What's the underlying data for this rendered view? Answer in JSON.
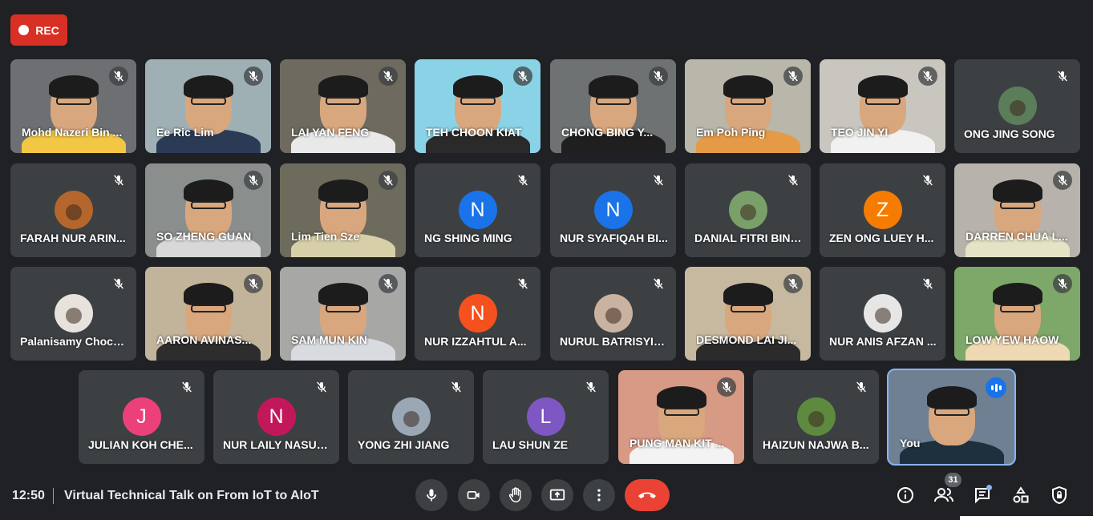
{
  "recording": {
    "label": "REC",
    "color": "#d93025"
  },
  "participants": [
    {
      "name": "Mohd Nazeri Bin ...",
      "type": "video",
      "bg": "#6d6f72",
      "shirt": "#f2c744"
    },
    {
      "name": "Ee Ric Lim",
      "type": "video",
      "bg": "#9fb0b5",
      "shirt": "#2b3a55"
    },
    {
      "name": "LAI YAN FENG",
      "type": "video",
      "bg": "#6e6a5f",
      "shirt": "#e9e9e9"
    },
    {
      "name": "TEH CHOON KIAT",
      "type": "video",
      "bg": "#8ad3e6",
      "shirt": "#2a2a2a"
    },
    {
      "name": "CHONG BING Y...",
      "type": "video",
      "bg": "#6f7272",
      "shirt": "#1f1f1f"
    },
    {
      "name": "Em Poh Ping",
      "type": "video",
      "bg": "#b9b6aa",
      "shirt": "#e59a47"
    },
    {
      "name": "TEO JIN YI",
      "type": "video",
      "bg": "#c9c6c0",
      "shirt": "#f1f1f1"
    },
    {
      "name": "ONG JING SONG",
      "type": "avatar-photo",
      "avatar_color": "#5c7d5a"
    },
    {
      "name": "FARAH NUR ARIN...",
      "type": "avatar-photo",
      "avatar_color": "#b4662c"
    },
    {
      "name": "SO ZHENG GUAN",
      "type": "video",
      "bg": "#8a8f8e",
      "shirt": "#d8d8d8"
    },
    {
      "name": "Lim Tien Sze",
      "type": "video",
      "bg": "#6d6b5c",
      "shirt": "#d7cfa7"
    },
    {
      "name": "NG SHING MING",
      "type": "avatar-letter",
      "letter": "N",
      "avatar_color": "#1a73e8"
    },
    {
      "name": "NUR SYAFIQAH BI...",
      "type": "avatar-letter",
      "letter": "N",
      "avatar_color": "#1a73e8"
    },
    {
      "name": "DANIAL FITRI BIN ...",
      "type": "avatar-photo",
      "avatar_color": "#7aa06a"
    },
    {
      "name": "ZEN ONG LUEY H...",
      "type": "avatar-letter",
      "letter": "Z",
      "avatar_color": "#f57c00"
    },
    {
      "name": "DARREN CHUA L...",
      "type": "video",
      "bg": "#b7b2ab",
      "shirt": "#e3e4c5"
    },
    {
      "name": "Palanisamy Chock...",
      "type": "avatar-photo",
      "avatar_color": "#e7e3dc"
    },
    {
      "name": "AARON AVINAS...",
      "type": "video",
      "bg": "#c2b49a",
      "shirt": "#2d2d2d"
    },
    {
      "name": "SAM MUN KIN",
      "type": "video",
      "bg": "#a7a8a6",
      "shirt": "#d8dbe0"
    },
    {
      "name": "NUR IZZAHTUL A...",
      "type": "avatar-letter",
      "letter": "N",
      "avatar_color": "#f4511e"
    },
    {
      "name": "NURUL BATRISYIA ...",
      "type": "avatar-photo",
      "avatar_color": "#c9b3a0"
    },
    {
      "name": "DESMOND LAI JI...",
      "type": "video",
      "bg": "#c7b8a0",
      "shirt": "#2b2b2b"
    },
    {
      "name": "NUR ANIS AFZAN ...",
      "type": "avatar-photo",
      "avatar_color": "#e6e6e6"
    },
    {
      "name": "LOW YEW HAOW",
      "type": "video",
      "bg": "#7ea86a",
      "shirt": "#efd9b4"
    },
    {
      "name": "JULIAN KOH CHE...",
      "type": "avatar-letter",
      "letter": "J",
      "avatar_color": "#ec407a"
    },
    {
      "name": "NUR LAILY NASUT...",
      "type": "avatar-letter",
      "letter": "N",
      "avatar_color": "#c2185b"
    },
    {
      "name": "YONG ZHI JIANG",
      "type": "avatar-photo",
      "avatar_color": "#9aa7b5"
    },
    {
      "name": "LAU SHUN ZE",
      "type": "avatar-letter",
      "letter": "L",
      "avatar_color": "#7e57c2"
    },
    {
      "name": "PUNG MAN KIT ...",
      "type": "video",
      "bg": "#d79a85",
      "shirt": "#f3f3f3"
    },
    {
      "name": "HAIZUN NAJWA B...",
      "type": "avatar-photo",
      "avatar_color": "#5d8a3e"
    },
    {
      "name": "You",
      "type": "video",
      "bg": "#6f8093",
      "shirt": "#1e2f3d",
      "self": true
    }
  ],
  "bottom_bar": {
    "time": "12:50",
    "meeting_title": "Virtual Technical Talk on From IoT to AIoT",
    "controls": [
      "microphone",
      "camera",
      "raise-hand",
      "present-screen",
      "more-options",
      "leave-call"
    ],
    "right_controls": [
      "meeting-details",
      "people",
      "chat",
      "activities",
      "host-controls"
    ],
    "people_count": "31",
    "hangup_color": "#ea4335"
  }
}
